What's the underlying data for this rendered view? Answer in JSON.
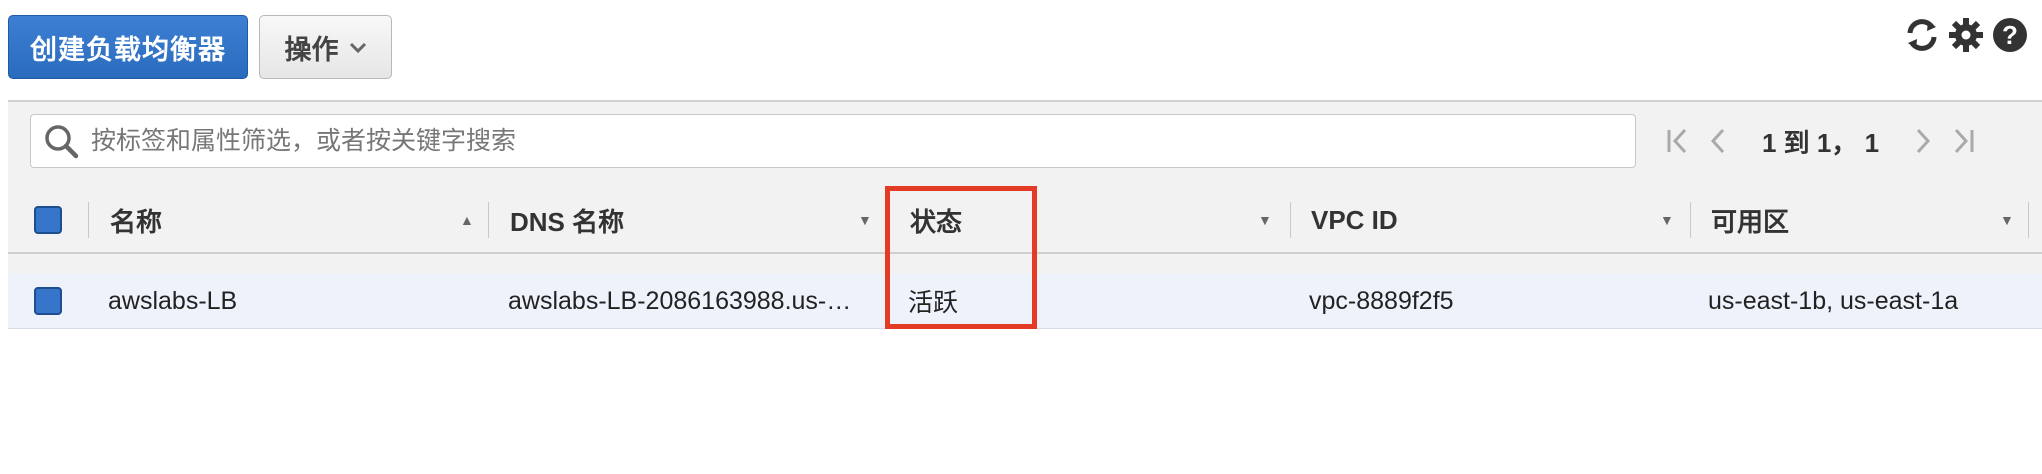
{
  "toolbar": {
    "create_label": "创建负载均衡器",
    "actions_label": "操作",
    "icons": [
      "refresh-icon",
      "gear-icon",
      "help-icon"
    ]
  },
  "search": {
    "placeholder": "按标签和属性筛选，或者按关键字搜索",
    "value": ""
  },
  "pagination": {
    "text": "1 到 1， 1"
  },
  "table": {
    "columns": [
      "名称",
      "DNS 名称",
      "状态",
      "VPC ID",
      "可用区"
    ],
    "sort_indicators": [
      "▲",
      "▼",
      "▼",
      "▼",
      "▼"
    ],
    "rows": [
      {
        "name": "awslabs-LB",
        "dns": "awslabs-LB-2086163988.us-…",
        "state": "活跃",
        "vpc_id": "vpc-8889f2f5",
        "zones": "us-east-1b, us-east-1a"
      }
    ]
  },
  "colors": {
    "primary": "#2a6bbd",
    "highlight": "#e33b25",
    "row_selected_bg": "#eef3fb"
  }
}
